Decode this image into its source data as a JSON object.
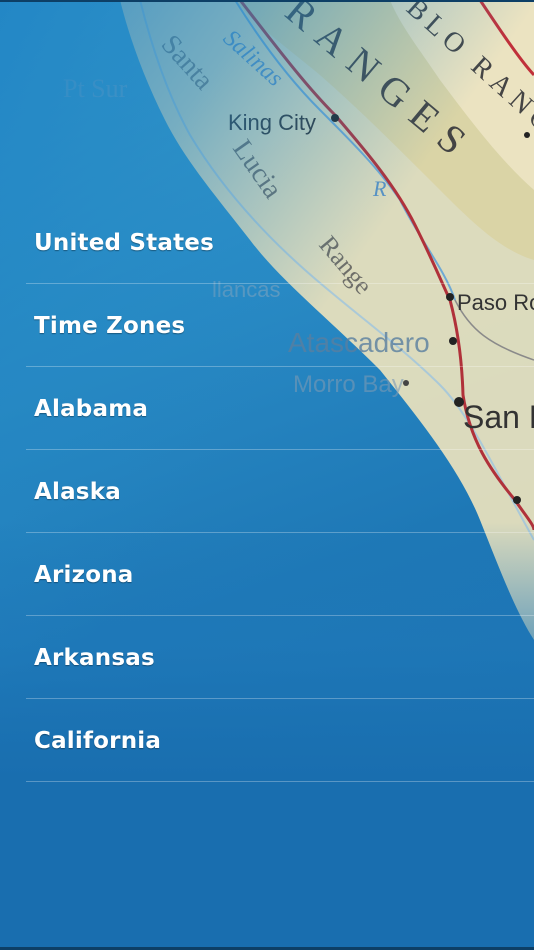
{
  "menu": {
    "items": [
      {
        "label": "United States"
      },
      {
        "label": "Time Zones"
      },
      {
        "label": "Alabama"
      },
      {
        "label": "Alaska"
      },
      {
        "label": "Arizona"
      },
      {
        "label": "Arkansas"
      },
      {
        "label": "California"
      }
    ]
  },
  "background_map": {
    "labels": {
      "pt_sur": "Pt Sur",
      "santa": "Santa",
      "salinas": "Salinas",
      "king_city": "King City",
      "lucia": "Lucia",
      "ranges": "RANGES",
      "blo_rang": "BLO RANG",
      "range": "Range",
      "r": "R",
      "llancas": "llancas",
      "paso": "Paso Ro",
      "atascadero": "Atascadero",
      "morro_bay": "Morro Bay",
      "san_l": "San L"
    }
  },
  "colors": {
    "background_blue": "#2a8cc6",
    "map_land": "#e9e2c0",
    "map_hills": "#dcd6a8",
    "road_red": "#b0313a",
    "water_blue": "#7fb4d6",
    "text_white": "#ffffff"
  }
}
